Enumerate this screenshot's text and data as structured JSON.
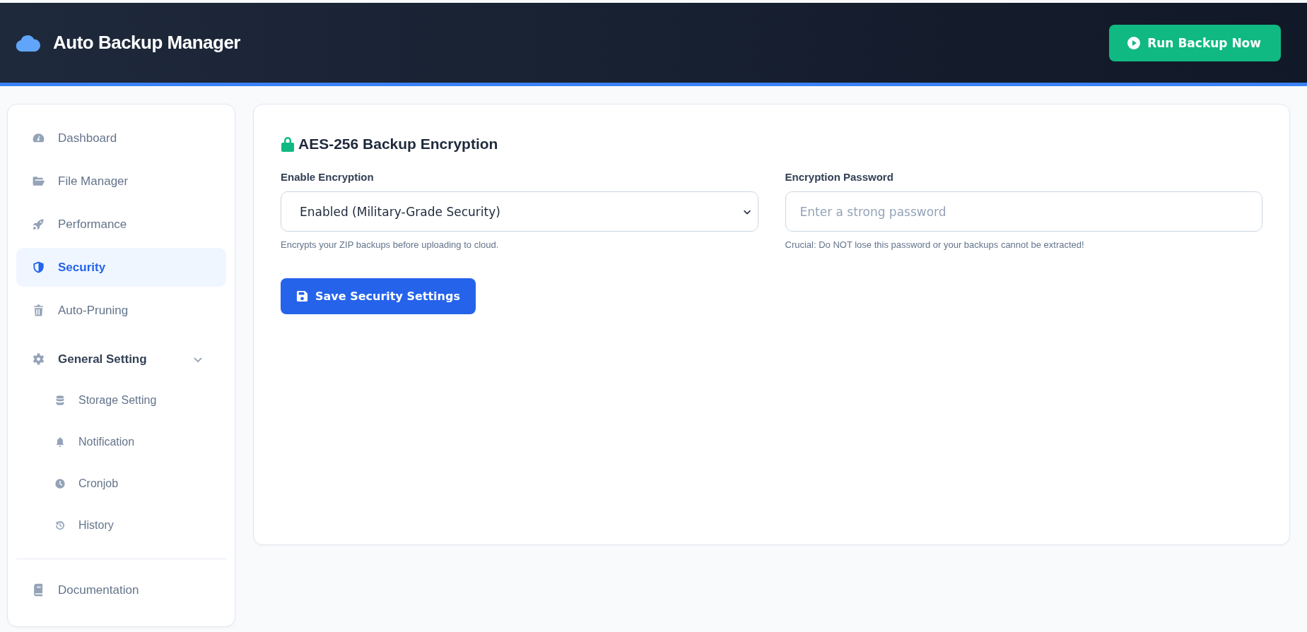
{
  "header": {
    "title": "Auto Backup Manager",
    "run_button": "Run Backup Now"
  },
  "sidebar": {
    "items": [
      {
        "label": "Dashboard",
        "selected": false
      },
      {
        "label": "File Manager",
        "selected": false
      },
      {
        "label": "Performance",
        "selected": false
      },
      {
        "label": "Security",
        "selected": true
      },
      {
        "label": "Auto-Pruning",
        "selected": false
      },
      {
        "label": "General Setting",
        "selected": false,
        "expanded": true,
        "children": [
          {
            "label": "Storage Setting",
            "selected": false
          },
          {
            "label": "Notification",
            "selected": false
          },
          {
            "label": "Cronjob",
            "selected": false
          },
          {
            "label": "History",
            "selected": false
          }
        ]
      }
    ],
    "footer_items": [
      {
        "label": "Documentation",
        "selected": false
      }
    ]
  },
  "panel": {
    "title": "AES-256 Backup Encryption",
    "fields": [
      {
        "kind": "select",
        "label": "Enable Encryption",
        "value": "Enabled (Military-Grade Security)",
        "hint": "Encrypts your ZIP backups before uploading to cloud."
      },
      {
        "kind": "password",
        "label": "Encryption Password",
        "placeholder": "Enter a strong password",
        "hint": "Crucial: Do NOT lose this password or your backups cannot be extracted!"
      }
    ],
    "save_button": "Save Security Settings"
  }
}
